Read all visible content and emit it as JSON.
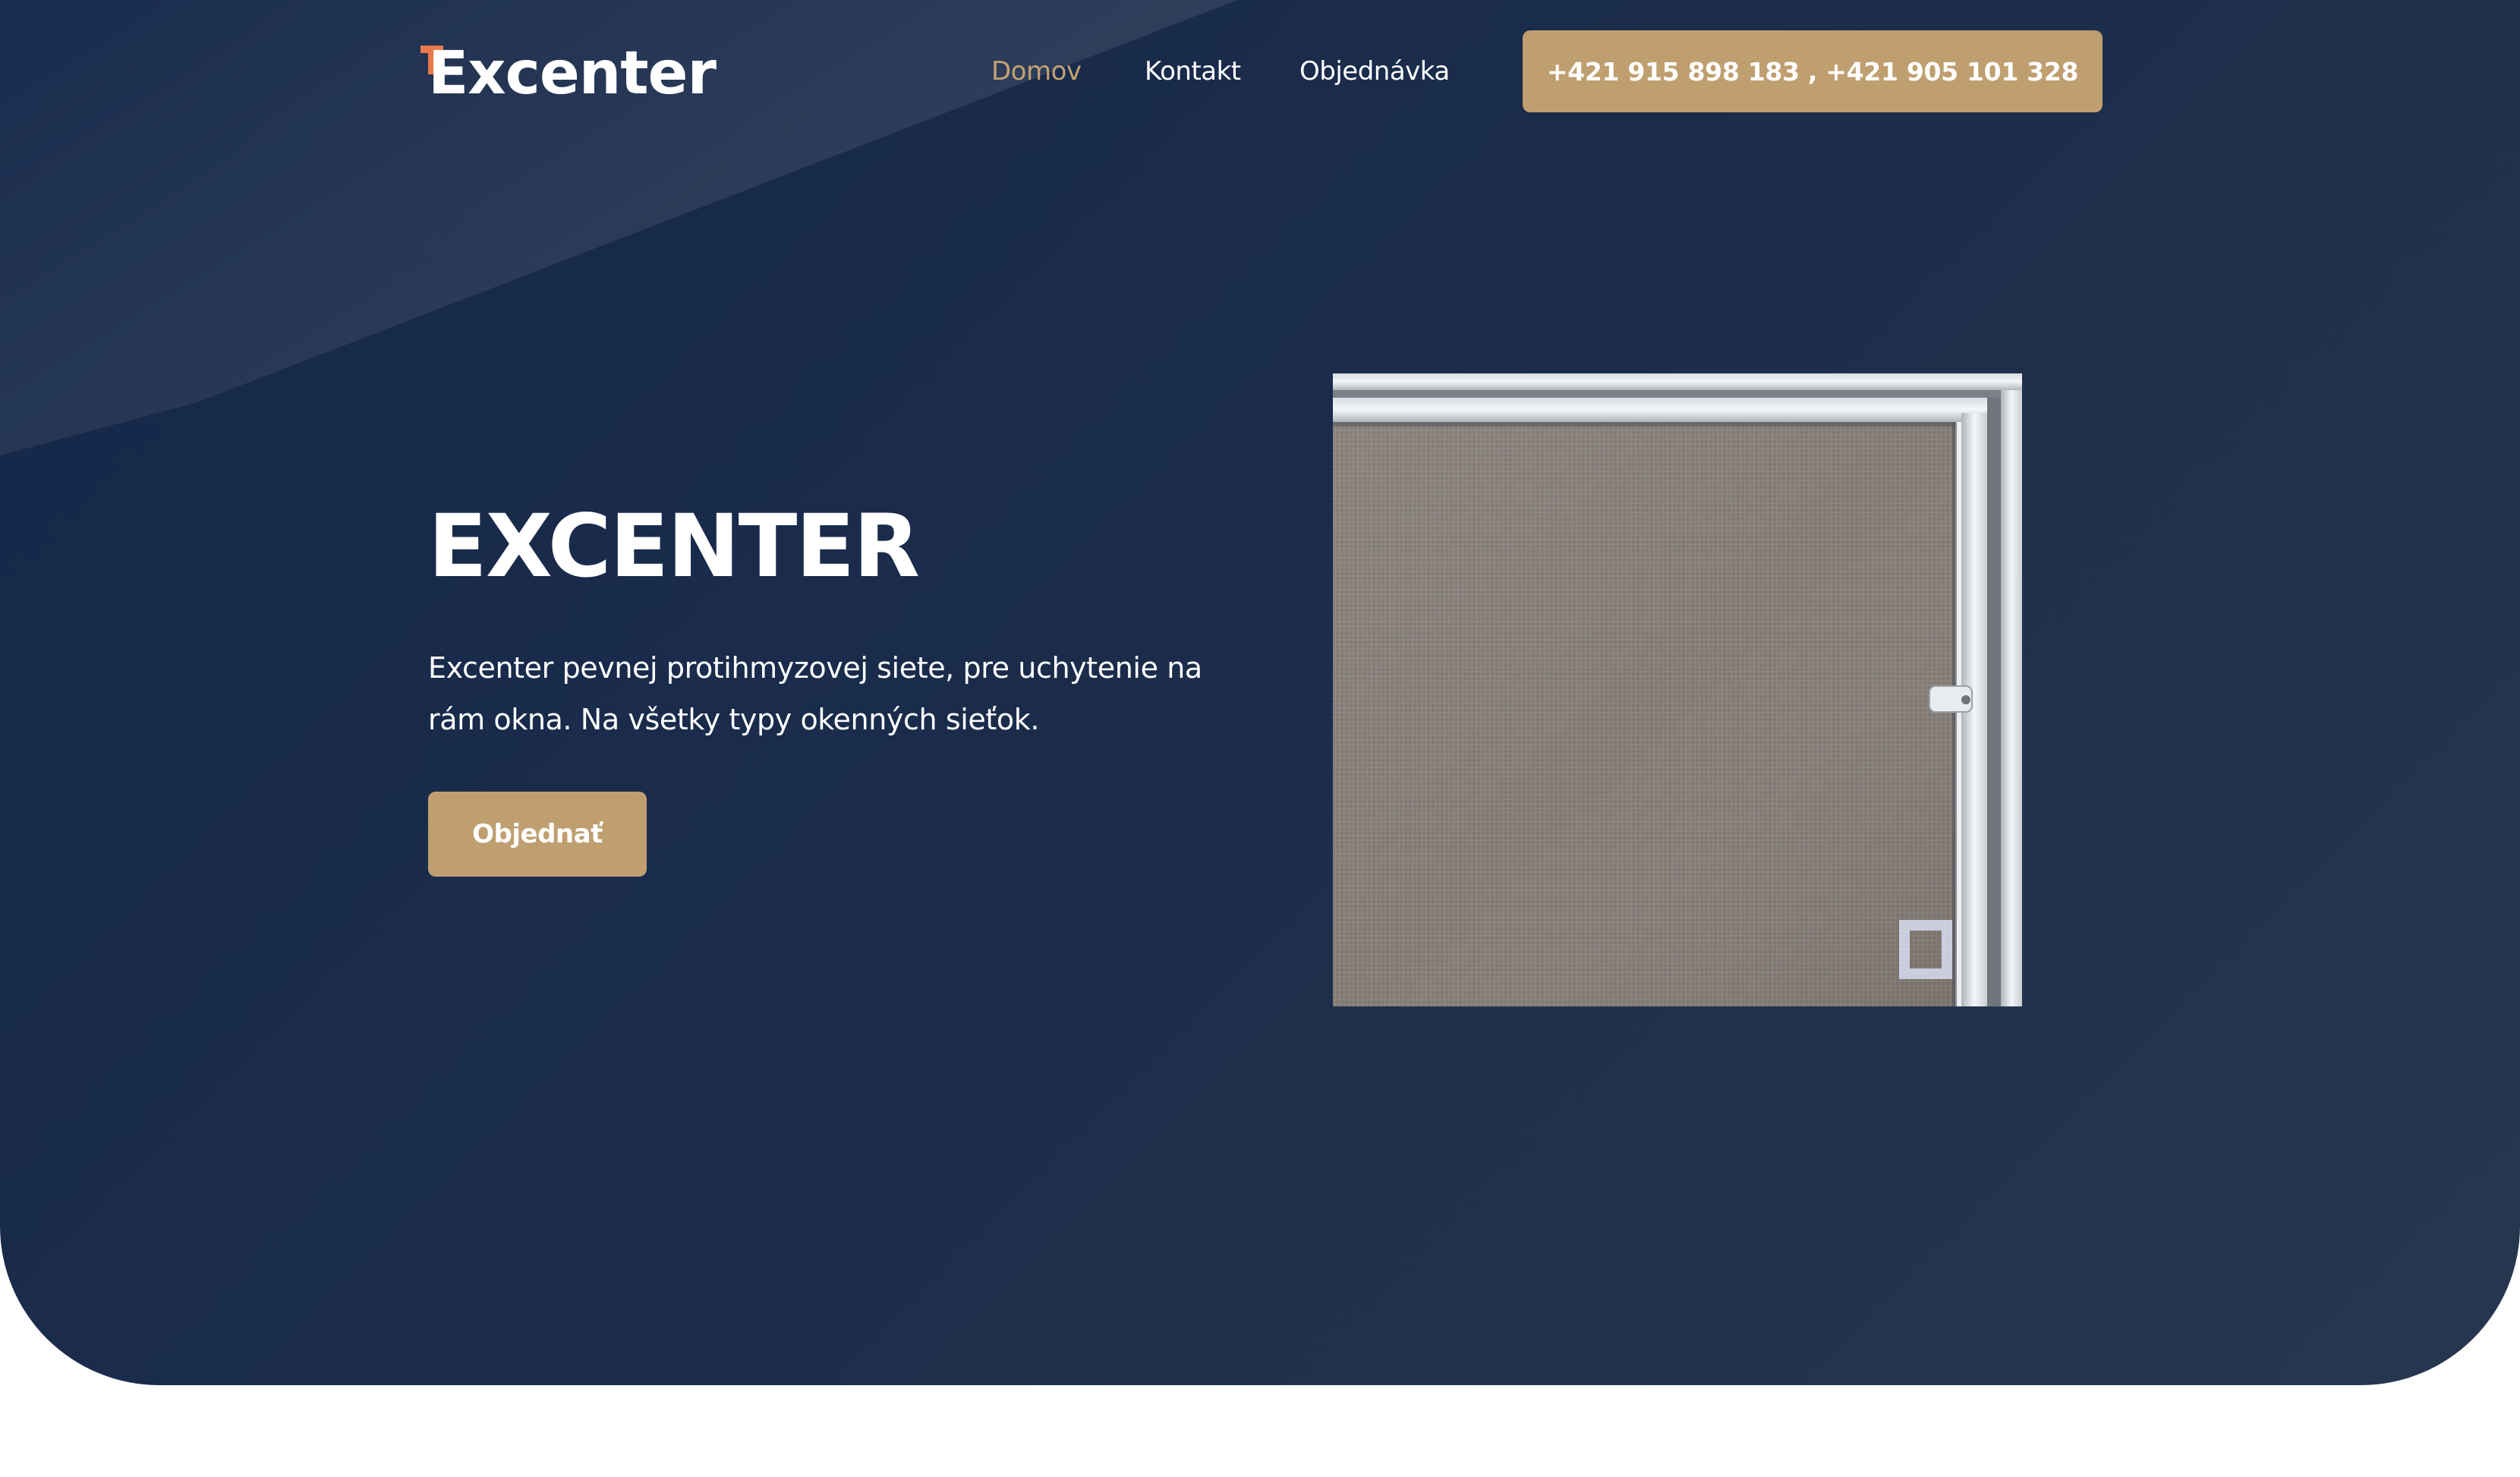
{
  "brand": {
    "logo_text": "Excenter",
    "logo_accent_color": "#e8794a"
  },
  "nav": {
    "items": [
      {
        "label": "Domov",
        "active": true
      },
      {
        "label": "Kontakt",
        "active": false
      },
      {
        "label": "Objednávka",
        "active": false
      }
    ],
    "phone_label": "+421 915 898 183 , +421 905 101 328"
  },
  "hero": {
    "title": "EXCENTER",
    "description": "Excenter pevnej protihmyzovej siete, pre uchytenie na rám okna. Na všetky typy okenných sieťok.",
    "order_label": "Objednať",
    "image_icon": "insect-screen-frame-photo"
  },
  "colors": {
    "hero_background": "#1b2c4b",
    "accent": "#bf9f70",
    "active_nav": "#c2a173",
    "text": "#ffffff"
  }
}
